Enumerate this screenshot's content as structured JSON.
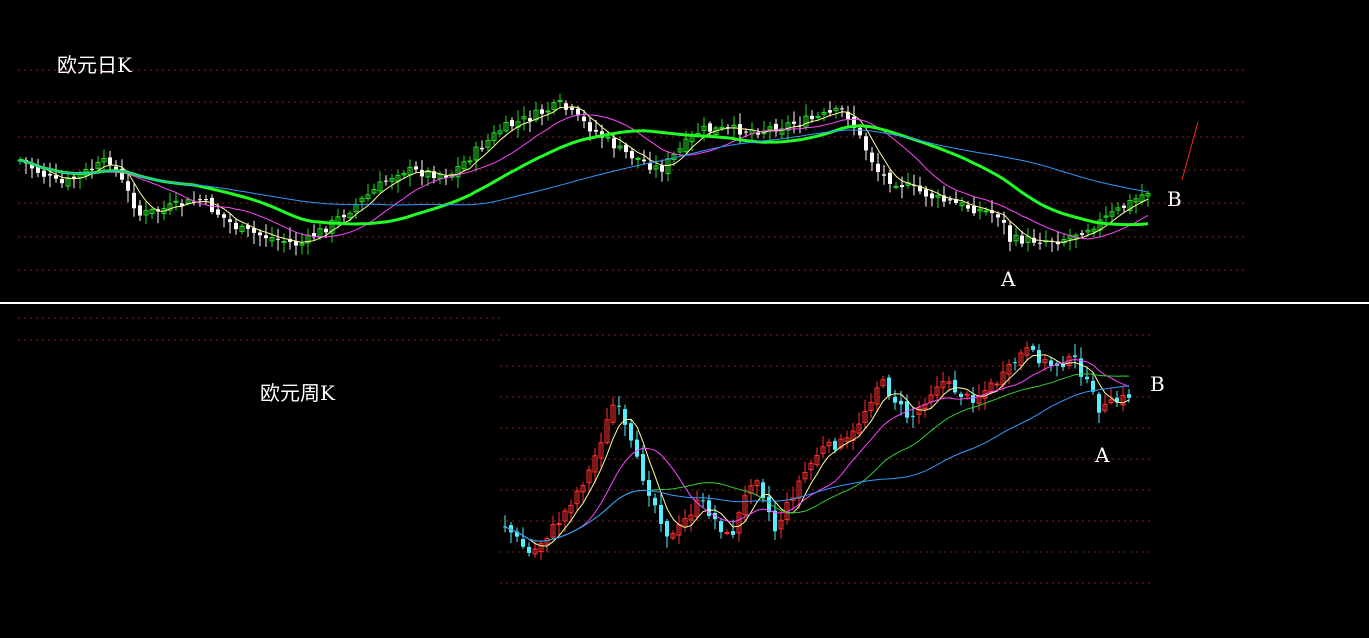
{
  "daily": {
    "title": "欧元日K",
    "marker_a": "A",
    "marker_b": "B"
  },
  "weekly": {
    "title": "欧元周K",
    "marker_a": "A",
    "marker_b": "B"
  },
  "colors": {
    "background": "#000000",
    "daily_up": "#22dd22",
    "daily_down": "#ffffff",
    "weekly_up": "#ff3030",
    "weekly_down": "#55eeff",
    "grid": "#7a2020",
    "divider": "#ffffff",
    "ma_short": "#ffffa0",
    "ma_mid": "#ff44ff",
    "ma_long_daily": "#22ff22",
    "ma_long_blue": "#3399ff",
    "ma_weekly_green": "#33cc33"
  },
  "chart_data": [
    {
      "type": "candlestick",
      "title": "欧元日K",
      "annotations": [
        "A",
        "B"
      ],
      "grid": true
    },
    {
      "type": "candlestick",
      "title": "欧元周K",
      "annotations": [
        "A",
        "B"
      ],
      "grid": true
    }
  ]
}
